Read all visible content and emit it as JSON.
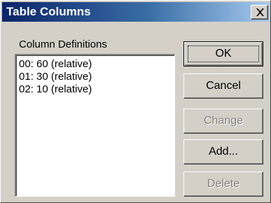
{
  "window": {
    "title": "Table Columns",
    "close_icon": "close-icon"
  },
  "column_definitions": {
    "label": "Column Definitions",
    "items": [
      "00: 60 (relative)",
      "01: 30 (relative)",
      "02: 10 (relative)"
    ]
  },
  "buttons": {
    "ok": "OK",
    "cancel": "Cancel",
    "change": "Change",
    "add": "Add...",
    "delete": "Delete"
  }
}
